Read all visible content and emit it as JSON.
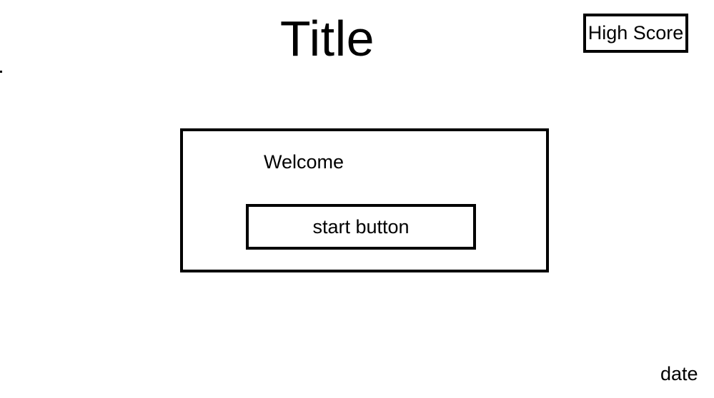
{
  "header": {
    "title": "Title",
    "high_score_label": "High Score"
  },
  "welcome_panel": {
    "welcome_text": "Welcome",
    "start_button_label": "start button"
  },
  "footer": {
    "date_label": "date"
  }
}
